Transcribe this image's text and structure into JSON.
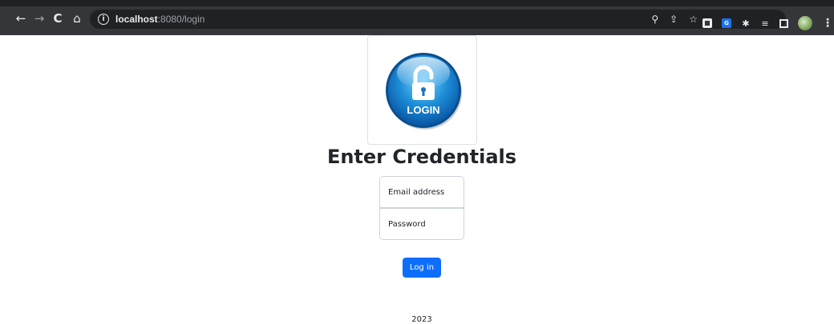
{
  "browser": {
    "url_host": "localhost",
    "url_path": ":8080/login",
    "icons": [
      "back-icon",
      "forward-icon",
      "reload-icon",
      "home-icon",
      "info-icon",
      "zoom-icon",
      "share-icon",
      "star-icon",
      "extensions-icon",
      "reading-list-icon",
      "side-panel-icon",
      "profile-avatar",
      "menu-icon"
    ]
  },
  "logo": {
    "text": "LOGIN",
    "colors": {
      "ring": "#0a63b8",
      "center": "#2fa4e7",
      "lock": "#ffffff"
    }
  },
  "form": {
    "heading": "Enter Credentials",
    "email_placeholder": "Email address",
    "password_placeholder": "Password",
    "submit_label": "Log in"
  },
  "footer": {
    "text": "2023"
  },
  "theme": {
    "primary": "#0d6efd",
    "text": "#212529",
    "border": "#ced4da"
  }
}
